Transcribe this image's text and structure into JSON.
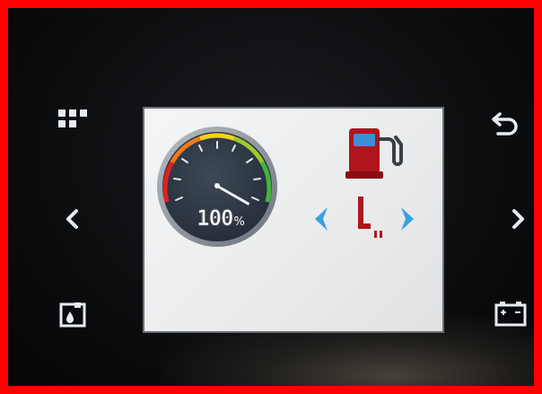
{
  "dashboard": {
    "fuel_level_percent": 100,
    "fuel_percent_value": "100",
    "fuel_percent_unit": "%"
  },
  "buttons": {
    "menu": "grid-menu-icon",
    "back": "return-arrow-icon",
    "left": "chevron-left-icon",
    "right": "chevron-right-icon",
    "fluid": "fluid-tank-icon",
    "battery": "battery-icon"
  },
  "colors": {
    "frame_border": "#ff0000",
    "bezel": "#0d0e10",
    "screen_bg": "#eceeef",
    "gauge_face": "#2f3a47",
    "gauge_rim": "#8d959d",
    "fuel_pump": "#b0141c",
    "fuel_window": "#3b8fd6",
    "nav_arrow": "#3aa0e0"
  }
}
